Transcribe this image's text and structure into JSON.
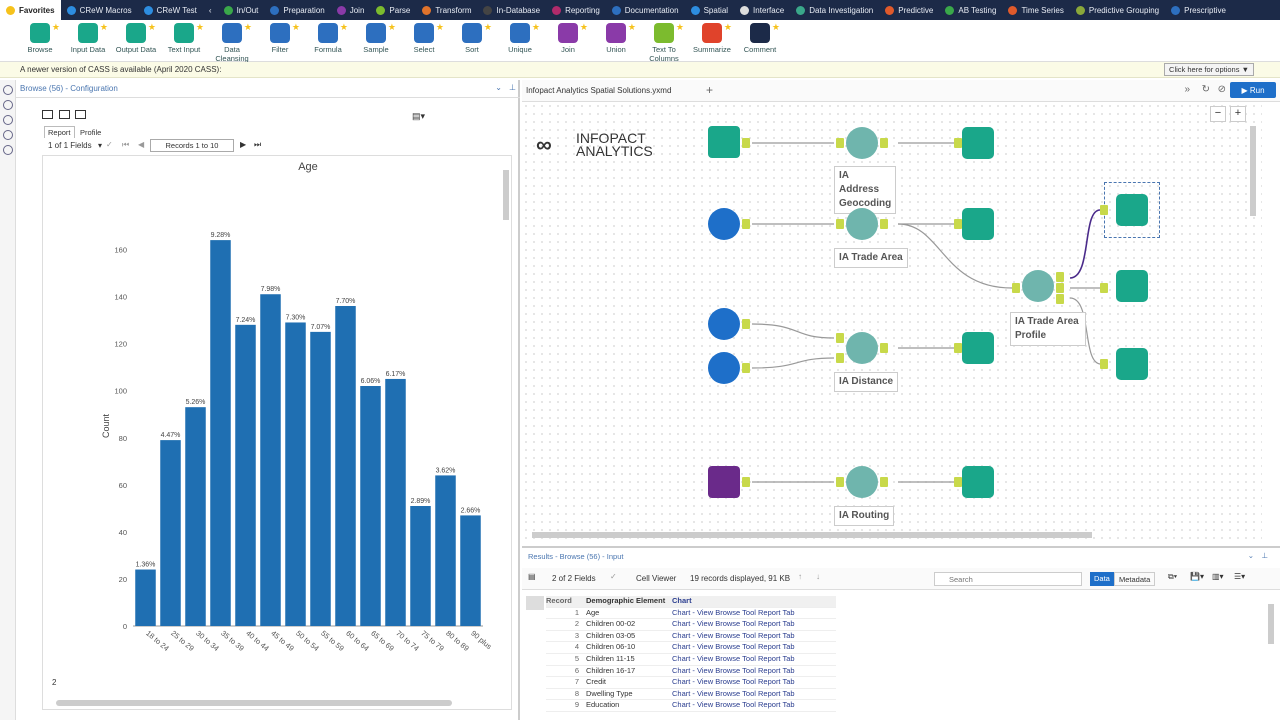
{
  "ribbon": {
    "categories": [
      {
        "label": "Favorites",
        "color": "#f6c21c"
      },
      {
        "label": "CReW Macros",
        "color": "#2d8de0"
      },
      {
        "label": "CReW Test",
        "color": "#2d8de0"
      },
      {
        "label": "In/Out",
        "color": "#3aa84a"
      },
      {
        "label": "Preparation",
        "color": "#2d6fbf"
      },
      {
        "label": "Join",
        "color": "#8a3aa8"
      },
      {
        "label": "Parse",
        "color": "#7cbb2e"
      },
      {
        "label": "Transform",
        "color": "#e0732b"
      },
      {
        "label": "In-Database",
        "color": "#444"
      },
      {
        "label": "Reporting",
        "color": "#b02b6b"
      },
      {
        "label": "Documentation",
        "color": "#2d6fbf"
      },
      {
        "label": "Spatial",
        "color": "#2d8de0"
      },
      {
        "label": "Interface",
        "color": "#ddd"
      },
      {
        "label": "Data Investigation",
        "color": "#3aa88a"
      },
      {
        "label": "Predictive",
        "color": "#e05a2b"
      },
      {
        "label": "AB Testing",
        "color": "#3aa84a"
      },
      {
        "label": "Time Series",
        "color": "#e05a2b"
      },
      {
        "label": "Predictive Grouping",
        "color": "#8aa83a"
      },
      {
        "label": "Prescriptive",
        "color": "#2d6fbf"
      }
    ],
    "tools": [
      {
        "label": "Browse",
        "color": "#1aa78a"
      },
      {
        "label": "Input Data",
        "color": "#1aa78a"
      },
      {
        "label": "Output Data",
        "color": "#1aa78a"
      },
      {
        "label": "Text Input",
        "color": "#1aa78a"
      },
      {
        "label": "Data Cleansing",
        "color": "#2d6fbf"
      },
      {
        "label": "Filter",
        "color": "#2d6fbf"
      },
      {
        "label": "Formula",
        "color": "#2d6fbf"
      },
      {
        "label": "Sample",
        "color": "#2d6fbf"
      },
      {
        "label": "Select",
        "color": "#2d6fbf"
      },
      {
        "label": "Sort",
        "color": "#2d6fbf"
      },
      {
        "label": "Unique",
        "color": "#2d6fbf"
      },
      {
        "label": "Join",
        "color": "#8a3aa8"
      },
      {
        "label": "Union",
        "color": "#8a3aa8"
      },
      {
        "label": "Text To Columns",
        "color": "#7cbb2e"
      },
      {
        "label": "Summarize",
        "color": "#e0432b"
      },
      {
        "label": "Comment",
        "color": "#1c2a48"
      }
    ]
  },
  "notice": {
    "text": "A newer version of CASS is available (April 2020 CASS):",
    "button": "Click here for options ▼"
  },
  "config": {
    "title": "Browse (56) - Configuration",
    "tabs": [
      "Report",
      "Profile"
    ],
    "fields": "1 of 1 Fields",
    "records": "Records 1 to 10",
    "footer_num": "2"
  },
  "chart_data": {
    "type": "bar",
    "title": "Age",
    "ylabel": "Count",
    "xlabel": "",
    "ylim": [
      0,
      170
    ],
    "yticks": [
      0,
      20,
      40,
      60,
      80,
      100,
      120,
      140,
      160
    ],
    "categories": [
      "18 to 24",
      "25 to 29",
      "30 to 34",
      "35 to 39",
      "40 to 44",
      "45 to 49",
      "50 to 54",
      "55 to 59",
      "60 to 64",
      "65 to 69",
      "70 to 74",
      "75 to 79",
      "80 to 89",
      "90 plus"
    ],
    "values": [
      24,
      79,
      93,
      164,
      128,
      141,
      129,
      125,
      136,
      102,
      105,
      51,
      64,
      47
    ],
    "labels": [
      "1.36%",
      "4.47%",
      "5.26%",
      "9.28%",
      "7.24%",
      "7.98%",
      "7.30%",
      "7.07%",
      "7.70%",
      "6.06%",
      "6.17%",
      "2.89%",
      "3.62%",
      "2.66%"
    ],
    "color": "#1f6fb2"
  },
  "canvas": {
    "tab": "Infopact Analytics Spatial Solutions.yxmd",
    "run": "Run",
    "logo_line1": "INFOPACT",
    "logo_line2": "ANALYTICS",
    "labels": {
      "geocoding": [
        "IA Address",
        "Geocoding"
      ],
      "trade_area": "IA Trade Area",
      "trade_profile": [
        "IA Trade Area",
        "Profile"
      ],
      "distance": "IA Distance",
      "routing": "IA Routing"
    }
  },
  "results": {
    "title": "Results - Browse (56) - Input",
    "fields": "2 of 2 Fields",
    "viewer": "Cell Viewer",
    "summary": "19 records displayed, 91 KB",
    "search_placeholder": "Search",
    "data_btn": "Data",
    "meta_btn": "Metadata",
    "columns": [
      "Record",
      "Demographic Element",
      "Chart"
    ],
    "rows": [
      [
        "1",
        "Age",
        "Chart - View Browse Tool Report Tab"
      ],
      [
        "2",
        "Children 00-02",
        "Chart - View Browse Tool Report Tab"
      ],
      [
        "3",
        "Children 03-05",
        "Chart - View Browse Tool Report Tab"
      ],
      [
        "4",
        "Children 06-10",
        "Chart - View Browse Tool Report Tab"
      ],
      [
        "5",
        "Children 11-15",
        "Chart - View Browse Tool Report Tab"
      ],
      [
        "6",
        "Children 16-17",
        "Chart - View Browse Tool Report Tab"
      ],
      [
        "7",
        "Credit",
        "Chart - View Browse Tool Report Tab"
      ],
      [
        "8",
        "Dwelling Type",
        "Chart - View Browse Tool Report Tab"
      ],
      [
        "9",
        "Education",
        "Chart - View Browse Tool Report Tab"
      ]
    ]
  }
}
